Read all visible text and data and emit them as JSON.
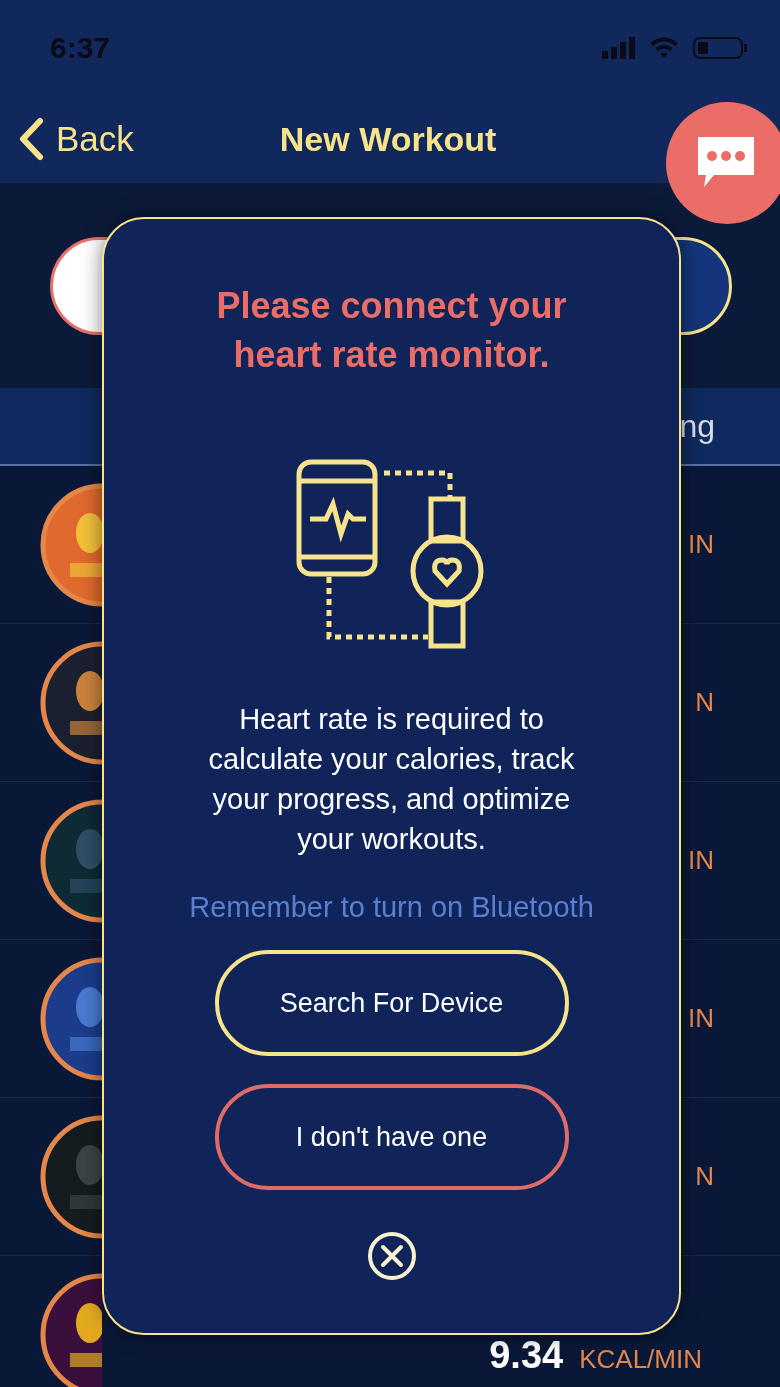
{
  "status_bar": {
    "time": "6:37"
  },
  "nav": {
    "back": "Back",
    "title": "New Workout"
  },
  "tab_row": {
    "visible_text": "ng"
  },
  "rows": [
    {
      "unit": "IN"
    },
    {
      "unit": "N"
    },
    {
      "unit": "IN"
    },
    {
      "unit": "IN"
    },
    {
      "unit": "N"
    },
    {
      "value": "9.34",
      "unit": "KCAL/MIN"
    }
  ],
  "dialog": {
    "title": "Please connect your heart rate monitor.",
    "message": "Heart rate is required to calculate your calories, track your progress, and optimize your workouts.",
    "note": "Remember to turn on Bluetooth",
    "buttons": [
      {
        "label": "Search For Device",
        "kind": "primary"
      },
      {
        "label": "I don't have one",
        "kind": "secondary"
      }
    ]
  }
}
